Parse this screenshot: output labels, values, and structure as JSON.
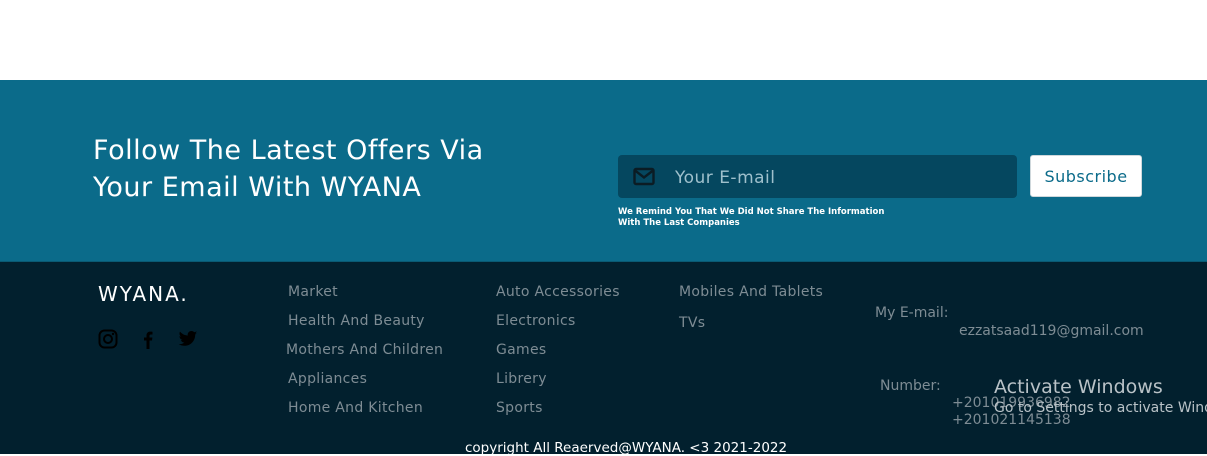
{
  "newsletter": {
    "heading_line1": "Follow The Latest Offers Via",
    "heading_line2": "Your Email With WYANA",
    "email_placeholder": "Your E-mail",
    "subscribe_label": "Subscribe",
    "note_line1": "We Remind You That We Did Not Share The Information",
    "note_line2": "With The Last Companies",
    "mail_icon": "envelope-icon"
  },
  "footer": {
    "brand": "WYANA.",
    "social_icons": [
      "instagram-icon",
      "facebook-icon",
      "twitter-icon"
    ],
    "links_col1": [
      "Market",
      "Health And Beauty",
      "Mothers And Children",
      "Appliances",
      "Home And Kitchen"
    ],
    "links_col2": [
      "Auto Accessories",
      "Electronics",
      "Games",
      "Librery",
      "Sports"
    ],
    "links_col3": [
      "Mobiles And Tablets",
      "TVs"
    ],
    "email_label": "My E-mail:",
    "email_value": "ezzatsaad119@gmail.com",
    "number_label": "Number:",
    "number_values": [
      "+201019936982",
      "+201021145138"
    ],
    "copyright": "copyright All Reaerved@WYANA. <3 2021-2022"
  },
  "os_overlay": {
    "title": "Activate Windows",
    "subtitle": "Go to Settings to activate Windo"
  },
  "colors": {
    "newsletter_bg": "#0b6b8a",
    "input_bg": "#05475f",
    "footer_bg": "#02202e",
    "link_text": "#7e8c94"
  }
}
